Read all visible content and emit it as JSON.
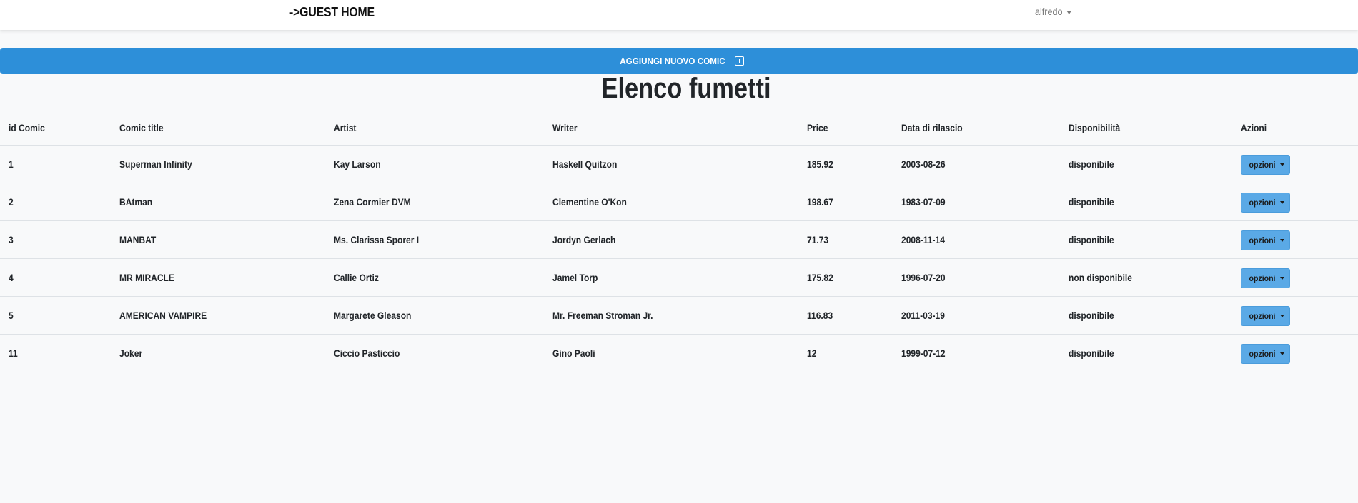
{
  "navbar": {
    "brand": "->GUEST HOME",
    "user": "alfredo"
  },
  "actions": {
    "add_comic_label": "AGGIUNGI NUOVO COMIC"
  },
  "page": {
    "title": "Elenco fumetti"
  },
  "table": {
    "headers": [
      "id Comic",
      "Comic title",
      "Artist",
      "Writer",
      "Price",
      "Data di rilascio",
      "Disponibilità",
      "Azioni"
    ],
    "rows": [
      {
        "id": "1",
        "title": "Superman Infinity",
        "artist": "Kay Larson",
        "writer": "Haskell Quitzon",
        "price": "185.92",
        "date": "2003-08-26",
        "availability": "disponibile",
        "action": "opzioni"
      },
      {
        "id": "2",
        "title": "BAtman",
        "artist": "Zena Cormier DVM",
        "writer": "Clementine O'Kon",
        "price": "198.67",
        "date": "1983-07-09",
        "availability": "disponibile",
        "action": "opzioni"
      },
      {
        "id": "3",
        "title": "MANBAT",
        "artist": "Ms. Clarissa Sporer I",
        "writer": "Jordyn Gerlach",
        "price": "71.73",
        "date": "2008-11-14",
        "availability": "disponibile",
        "action": "opzioni"
      },
      {
        "id": "4",
        "title": "MR MIRACLE",
        "artist": "Callie Ortiz",
        "writer": "Jamel Torp",
        "price": "175.82",
        "date": "1996-07-20",
        "availability": "non disponibile",
        "action": "opzioni"
      },
      {
        "id": "5",
        "title": "AMERICAN VAMPIRE",
        "artist": "Margarete Gleason",
        "writer": "Mr. Freeman Stroman Jr.",
        "price": "116.83",
        "date": "2011-03-19",
        "availability": "disponibile",
        "action": "opzioni"
      },
      {
        "id": "11",
        "title": "Joker",
        "artist": "Ciccio Pasticcio",
        "writer": "Gino Paoli",
        "price": "12",
        "date": "1999-07-12",
        "availability": "disponibile",
        "action": "opzioni"
      }
    ]
  },
  "colors": {
    "accent": "#2d8fd9",
    "options_button": "#5aa9e6",
    "background": "#f8f9fa"
  },
  "icons": {
    "add": "plus-square-icon",
    "dropdown": "caret-down-icon"
  }
}
